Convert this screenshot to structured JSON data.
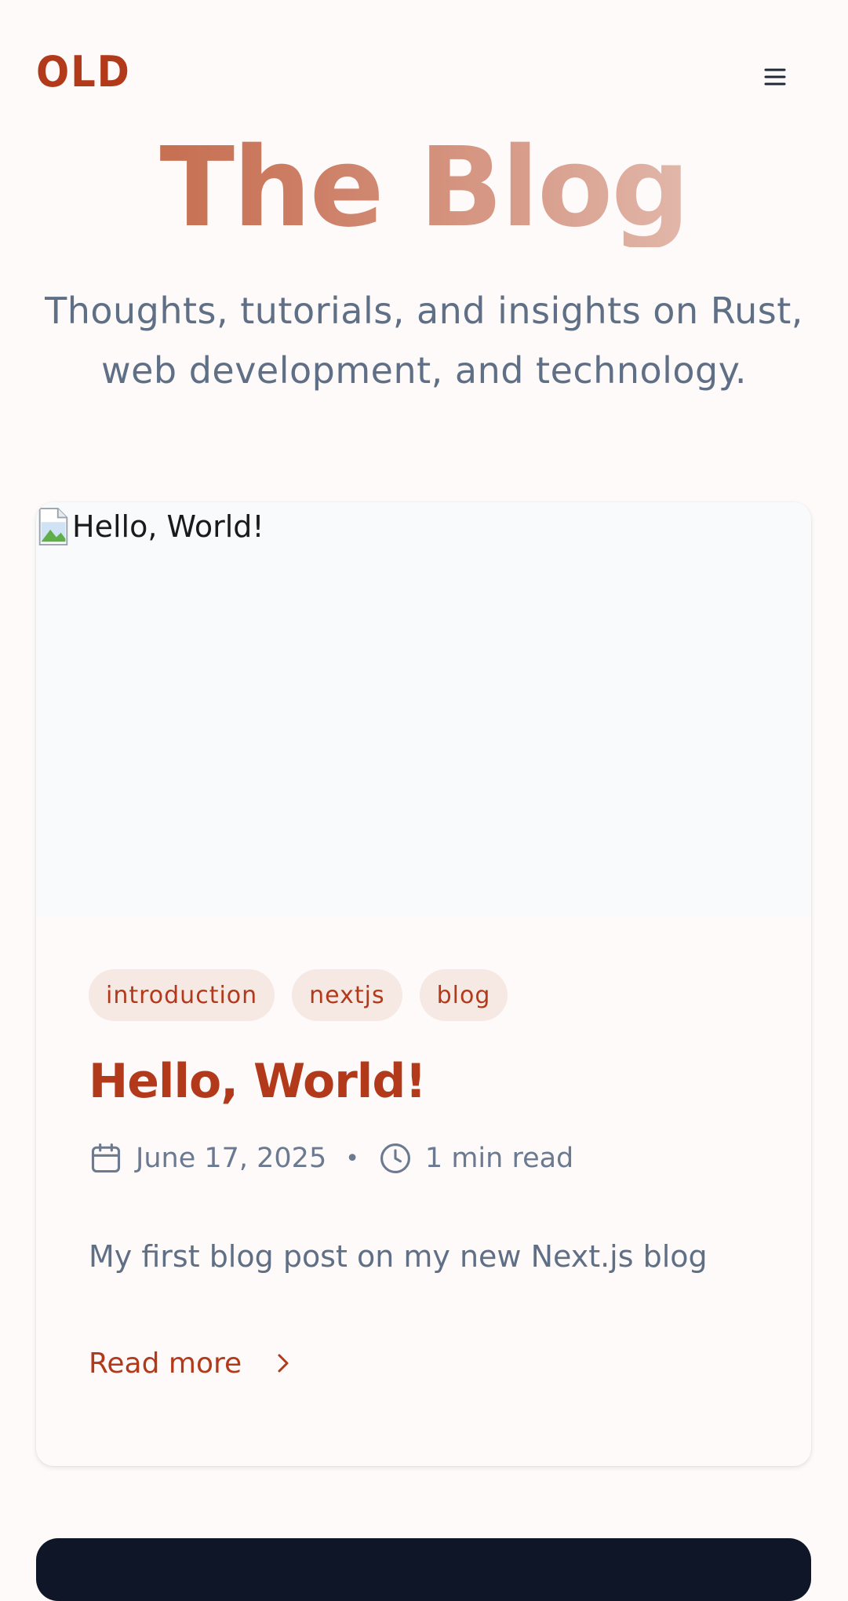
{
  "header": {
    "logo": "OLD",
    "menu_icon": "hamburger-menu-icon"
  },
  "hero": {
    "title": "The Blog",
    "subtitle": "Thoughts, tutorials, and insights on Rust, web development, and technology."
  },
  "post": {
    "image_alt": "Hello, World!",
    "image_icon": "broken-image-icon",
    "tags": [
      "introduction",
      "nextjs",
      "blog"
    ],
    "title": "Hello, World!",
    "date": "June 17, 2025",
    "date_icon": "calendar-icon",
    "separator": "•",
    "read_time": "1 min read",
    "read_time_icon": "clock-icon",
    "excerpt": "My first blog post on my new Next.js blog",
    "read_more": "Read more",
    "read_more_icon": "chevron-right-icon"
  },
  "colors": {
    "brand": "#b23a1a",
    "muted_text": "#5f6f86",
    "tag_bg": "#f6e8e3",
    "page_bg": "#fdfaf9",
    "footer_bg": "#0e1628"
  }
}
